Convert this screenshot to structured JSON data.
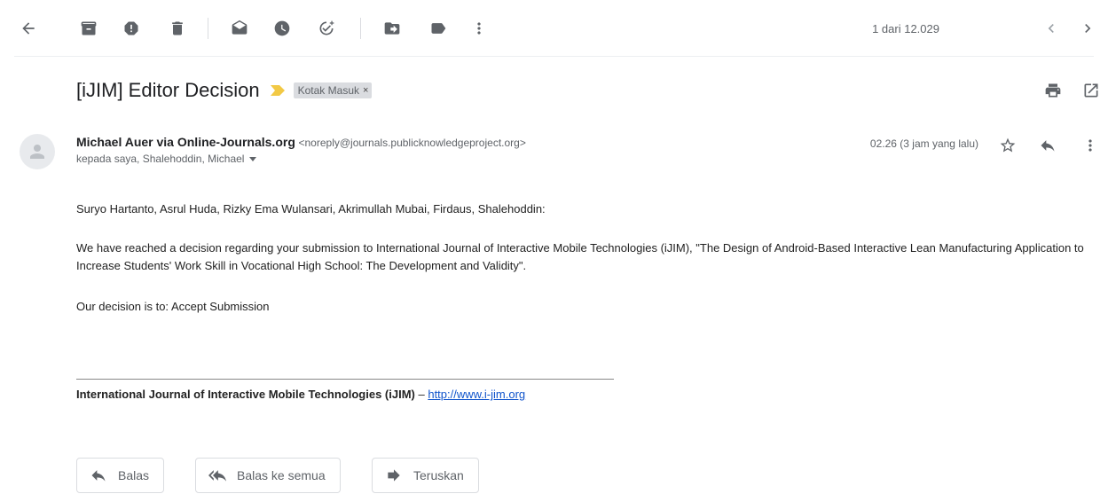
{
  "toolbar": {
    "back_icon": "arrow-back-icon",
    "icons": [
      "archive-icon",
      "report-spam-icon",
      "delete-icon",
      "mark-unread-icon",
      "snooze-icon",
      "add-to-tasks-icon",
      "move-to-icon",
      "labels-icon",
      "more-vert-icon"
    ],
    "pager_text": "1 dari 12.029"
  },
  "subject": {
    "title": "[iJIM] Editor Decision",
    "label": "Kotak Masuk",
    "label_close": "×",
    "important_color": "#f2c945"
  },
  "message": {
    "sender_name": "Michael Auer via Online-Journals.org",
    "sender_email": "<noreply@journals.publicknowledgeproject.org>",
    "recipients": "kepada saya, Shalehoddin, Michael",
    "timestamp": "02.26 (3 jam yang lalu)"
  },
  "body": {
    "greeting": "Suryo Hartanto, Asrul Huda, Rizky Ema Wulansari, Akrimullah Mubai, Firdaus, Shalehoddin:",
    "paragraph1": "We have reached a decision regarding your submission to International Journal of Interactive Mobile Technologies (iJIM), \"The Design of Android-Based Interactive Lean Manufacturing Application to Increase Students' Work Skill in Vocational High School: The Development and Validity\".",
    "paragraph2": "Our decision is to: Accept Submission",
    "signature_name": "International Journal of Interactive Mobile Technologies (iJIM)",
    "signature_sep": " – ",
    "signature_link": "http://www.i-jim.org"
  },
  "actions": {
    "reply": "Balas",
    "reply_all": "Balas ke semua",
    "forward": "Teruskan"
  },
  "colors": {
    "link": "#1155cc",
    "icon": "#5f6368",
    "chip_bg": "#dadce0"
  }
}
